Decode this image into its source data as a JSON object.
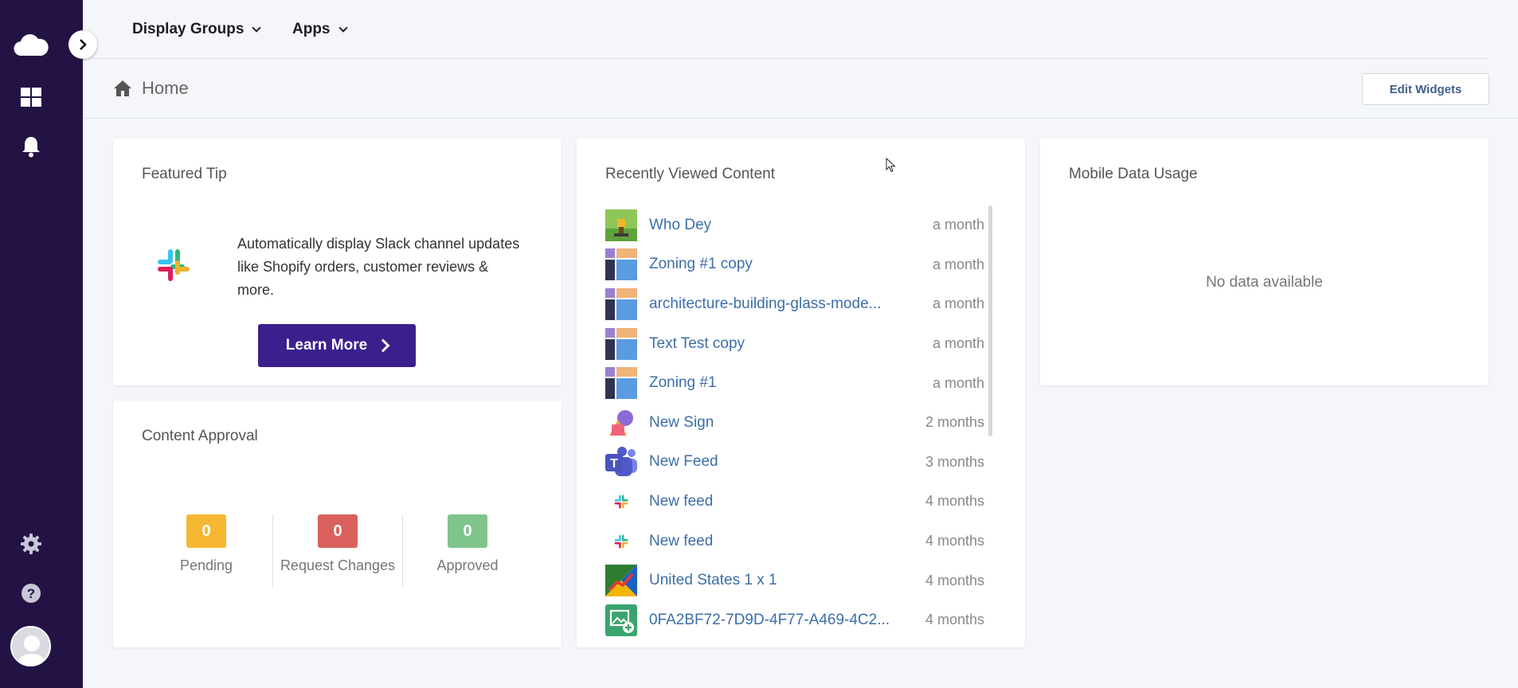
{
  "nav": {
    "display_groups": "Display Groups",
    "apps": "Apps"
  },
  "breadcrumb": {
    "home": "Home"
  },
  "toolbar": {
    "edit_widgets": "Edit Widgets"
  },
  "featured_tip": {
    "title": "Featured Tip",
    "text": "Automatically display Slack channel updates like Shopify orders, customer reviews & more.",
    "button": "Learn More"
  },
  "content_approval": {
    "title": "Content Approval",
    "pending": {
      "count": "0",
      "label": "Pending",
      "color": "#f5b731"
    },
    "request_changes": {
      "count": "0",
      "label": "Request Changes",
      "color": "#d9605d"
    },
    "approved": {
      "count": "0",
      "label": "Approved",
      "color": "#7fc58b"
    }
  },
  "recent": {
    "title": "Recently Viewed Content",
    "items": [
      {
        "title": "Who Dey",
        "time": "a month",
        "icon": "image-thumb-icon"
      },
      {
        "title": "Zoning #1 copy",
        "time": "a month",
        "icon": "zoning-layout-icon"
      },
      {
        "title": "architecture-building-glass-mode...",
        "time": "a month",
        "icon": "zoning-layout-icon"
      },
      {
        "title": "Text Test copy",
        "time": "a month",
        "icon": "zoning-layout-icon"
      },
      {
        "title": "Zoning #1",
        "time": "a month",
        "icon": "zoning-layout-icon"
      },
      {
        "title": "New Sign",
        "time": "2 months",
        "icon": "sign-shapes-icon"
      },
      {
        "title": "New Feed",
        "time": "3 months",
        "icon": "teams-icon"
      },
      {
        "title": "New feed",
        "time": "4 months",
        "icon": "slack-icon"
      },
      {
        "title": "New feed",
        "time": "4 months",
        "icon": "slack-icon"
      },
      {
        "title": "United States 1 x 1",
        "time": "4 months",
        "icon": "stats-chart-icon"
      },
      {
        "title": "0FA2BF72-7D9D-4F77-A469-4C2...",
        "time": "4 months",
        "icon": "image-add-icon"
      }
    ]
  },
  "mobile_data": {
    "title": "Mobile Data Usage",
    "empty": "No data available"
  },
  "colors": {
    "sidebar": "#231344",
    "accent": "#3b1f8d",
    "link": "#3c6ea8"
  }
}
